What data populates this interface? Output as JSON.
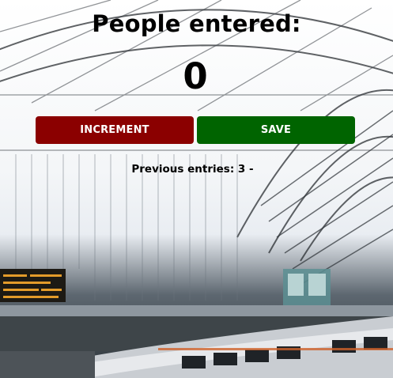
{
  "app": {
    "title": "People entered:",
    "count": "0",
    "increment_label": "INCREMENT",
    "save_label": "SAVE",
    "previous_entries": "Previous entries: 3 -"
  },
  "colors": {
    "increment_button": "#8b0000",
    "save_button": "#006400",
    "text": "#000000"
  }
}
